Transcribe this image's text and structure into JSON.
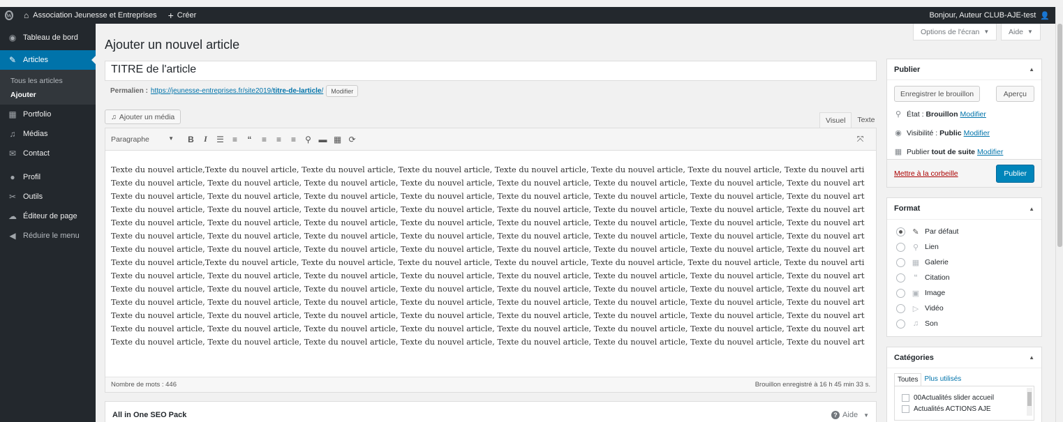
{
  "admin_bar": {
    "site_name": "Association Jeunesse et Entreprises",
    "new_label": "Créer",
    "greeting": "Bonjour, Auteur CLUB-AJE-test"
  },
  "sidebar": {
    "items": [
      {
        "label": "Tableau de bord",
        "icon": "dashboard-icon"
      },
      {
        "label": "Articles",
        "icon": "pin-icon"
      },
      {
        "label": "Portfolio",
        "icon": "portfolio-icon"
      },
      {
        "label": "Médias",
        "icon": "media-icon"
      },
      {
        "label": "Contact",
        "icon": "mail-icon"
      },
      {
        "label": "Profil",
        "icon": "user-icon"
      },
      {
        "label": "Outils",
        "icon": "wrench-icon"
      },
      {
        "label": "Éditeur de page",
        "icon": "page-builder-icon"
      },
      {
        "label": "Réduire le menu",
        "icon": "collapse-icon"
      }
    ],
    "submenu": [
      "Tous les articles",
      "Ajouter"
    ]
  },
  "header": {
    "screen_options": "Options de l'écran",
    "help": "Aide",
    "page_title": "Ajouter un nouvel article"
  },
  "post": {
    "title": "TITRE de l'article",
    "permalink_label": "Permalien :",
    "permalink_base": "https://jeunesse-entreprises.fr/site2019/",
    "permalink_slug": "titre-de-larticle",
    "permalink_end": "/",
    "permalink_edit": "Modifier"
  },
  "editor": {
    "add_media": "Ajouter un média",
    "tab_visual": "Visuel",
    "tab_text": "Texte",
    "format_select": "Paragraphe",
    "lines": [
      "Texte du nouvel article,Texte du nouvel article, Texte du nouvel article, Texte du nouvel article, Texte du nouvel article, Texte du nouvel article, Texte du nouvel article, Texte du nouvel article,",
      "Texte du nouvel article, Texte du nouvel article, Texte du nouvel article, Texte du nouvel article, Texte du nouvel article, Texte du nouvel article, Texte du nouvel article, Texte du nouvel article,",
      "Texte du nouvel article, Texte du nouvel article, Texte du nouvel article, Texte du nouvel article, Texte du nouvel article, Texte du nouvel article, Texte du nouvel article, Texte du nouvel article,",
      "Texte du nouvel article, Texte du nouvel article, Texte du nouvel article, Texte du nouvel article, Texte du nouvel article, Texte du nouvel article, Texte du nouvel article, Texte du nouvel article,",
      "Texte du nouvel article, Texte du nouvel article, Texte du nouvel article, Texte du nouvel article, Texte du nouvel article, Texte du nouvel article, Texte du nouvel article, Texte du nouvel article,",
      "Texte du nouvel article, Texte du nouvel article, Texte du nouvel article, Texte du nouvel article, Texte du nouvel article, Texte du nouvel article, Texte du nouvel article, Texte du nouvel article,",
      "Texte du nouvel article, Texte du nouvel article, Texte du nouvel article, Texte du nouvel article, Texte du nouvel article, Texte du nouvel article, Texte du nouvel article, Texte du nouvel article,",
      "Texte du nouvel article,Texte du nouvel article, Texte du nouvel article, Texte du nouvel article, Texte du nouvel article, Texte du nouvel article, Texte du nouvel article, Texte du nouvel article,",
      "Texte du nouvel article, Texte du nouvel article, Texte du nouvel article, Texte du nouvel article, Texte du nouvel article, Texte du nouvel article, Texte du nouvel article, Texte du nouvel article,",
      "Texte du nouvel article, Texte du nouvel article, Texte du nouvel article, Texte du nouvel article, Texte du nouvel article, Texte du nouvel article, Texte du nouvel article, Texte du nouvel article,",
      "Texte du nouvel article, Texte du nouvel article, Texte du nouvel article, Texte du nouvel article, Texte du nouvel article, Texte du nouvel article, Texte du nouvel article, Texte du nouvel article,",
      "Texte du nouvel article, Texte du nouvel article, Texte du nouvel article, Texte du nouvel article, Texte du nouvel article, Texte du nouvel article, Texte du nouvel article, Texte du nouvel article,",
      "Texte du nouvel article, Texte du nouvel article, Texte du nouvel article, Texte du nouvel article, Texte du nouvel article, Texte du nouvel article, Texte du nouvel article, Texte du nouvel article,",
      "Texte du nouvel article, Texte du nouvel article, Texte du nouvel article, Texte du nouvel article, Texte du nouvel article, Texte du nouvel article, Texte du nouvel article, Texte du nouvel article,"
    ],
    "word_count": "Nombre de mots : 446",
    "draft_saved": "Brouillon enregistré à 16 h 45 min 33 s."
  },
  "seo_box": {
    "title": "All in One SEO Pack",
    "help": "Aide"
  },
  "publish_box": {
    "title": "Publier",
    "save_draft": "Enregistrer le brouillon",
    "preview": "Aperçu",
    "status_label": "État :",
    "status_value": "Brouillon",
    "visibility_label": "Visibilité :",
    "visibility_value": "Public",
    "publish_label": "Publier",
    "publish_value": "tout de suite",
    "edit_link": "Modifier",
    "trash": "Mettre à la corbeille",
    "publish_button": "Publier"
  },
  "format_box": {
    "title": "Format",
    "options": [
      {
        "label": "Par défaut",
        "icon": "pin-icon",
        "selected": true
      },
      {
        "label": "Lien",
        "icon": "link-icon"
      },
      {
        "label": "Galerie",
        "icon": "gallery-icon"
      },
      {
        "label": "Citation",
        "icon": "quote-icon"
      },
      {
        "label": "Image",
        "icon": "image-icon"
      },
      {
        "label": "Vidéo",
        "icon": "video-icon"
      },
      {
        "label": "Son",
        "icon": "audio-icon"
      }
    ]
  },
  "categories_box": {
    "title": "Catégories",
    "tab_all": "Toutes",
    "tab_most_used": "Plus utilisés",
    "items": [
      "00Actualités slider accueil",
      "Actualités ACTIONS AJE"
    ]
  },
  "colors": {
    "accent": "#0073aa",
    "adminbar": "#23282d",
    "trash": "#a00"
  }
}
